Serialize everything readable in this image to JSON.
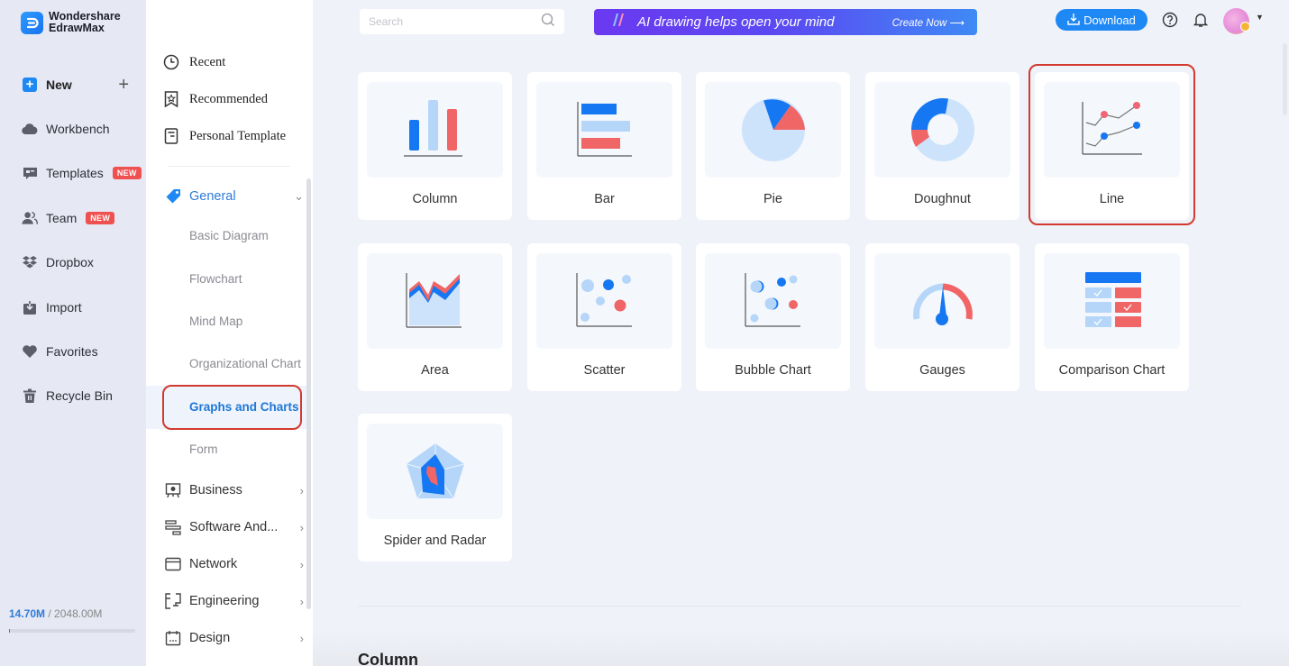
{
  "app": {
    "brand_line1": "Wondershare",
    "brand_line2": "EdrawMax"
  },
  "leftnav": {
    "new_label": "New",
    "items": [
      {
        "label": "Workbench",
        "icon": "cloud-icon"
      },
      {
        "label": "Templates",
        "icon": "template-chat-icon",
        "badge": "NEW"
      },
      {
        "label": "Team",
        "icon": "team-icon",
        "badge": "NEW"
      },
      {
        "label": "Dropbox",
        "icon": "dropbox-icon"
      },
      {
        "label": "Import",
        "icon": "import-icon"
      },
      {
        "label": "Favorites",
        "icon": "heart-icon"
      },
      {
        "label": "Recycle Bin",
        "icon": "trash-icon"
      }
    ],
    "storage": {
      "used": "14.70M",
      "separator": " / ",
      "total": "2048.00M",
      "used_fraction": 0.0072
    }
  },
  "categories": {
    "top_items": [
      {
        "label": "Recent",
        "icon": "clock-icon"
      },
      {
        "label": "Recommended",
        "icon": "star-bookmark-icon"
      },
      {
        "label": "Personal Template",
        "icon": "document-icon"
      }
    ],
    "general": {
      "label": "General",
      "expanded": true,
      "sub_items": [
        "Basic Diagram",
        "Flowchart",
        "Mind Map",
        "Organizational Chart",
        "Graphs and Charts",
        "Form"
      ],
      "active_sub_item": "Graphs and Charts"
    },
    "groups": [
      {
        "label": "Business",
        "icon": "presentation-icon"
      },
      {
        "label": "Software And...",
        "icon": "software-icon"
      },
      {
        "label": "Network",
        "icon": "network-window-icon"
      },
      {
        "label": "Engineering",
        "icon": "engineering-icon"
      },
      {
        "label": "Design",
        "icon": "calendar-design-icon"
      }
    ]
  },
  "topbar": {
    "search_placeholder": "Search",
    "ai_banner_text": "AI drawing helps open your mind",
    "ai_banner_cta": "Create Now",
    "download_label": "Download"
  },
  "colors": {
    "accent_blue": "#1e88f5",
    "chart_blue": "#1677f2",
    "chart_light_blue": "#b5d6f8",
    "chart_red": "#f06565",
    "selection_red": "#d33a2f"
  },
  "chart_types": [
    {
      "label": "Column",
      "icon": "column-chart-icon"
    },
    {
      "label": "Bar",
      "icon": "bar-chart-icon"
    },
    {
      "label": "Pie",
      "icon": "pie-chart-icon"
    },
    {
      "label": "Doughnut",
      "icon": "doughnut-chart-icon"
    },
    {
      "label": "Line",
      "icon": "line-chart-icon",
      "selected": true
    },
    {
      "label": "Area",
      "icon": "area-chart-icon"
    },
    {
      "label": "Scatter",
      "icon": "scatter-chart-icon"
    },
    {
      "label": "Bubble Chart",
      "icon": "bubble-chart-icon"
    },
    {
      "label": "Gauges",
      "icon": "gauge-icon"
    },
    {
      "label": "Comparison Chart",
      "icon": "comparison-chart-icon"
    },
    {
      "label": "Spider and Radar",
      "icon": "radar-chart-icon"
    }
  ],
  "next_section_title": "Column"
}
